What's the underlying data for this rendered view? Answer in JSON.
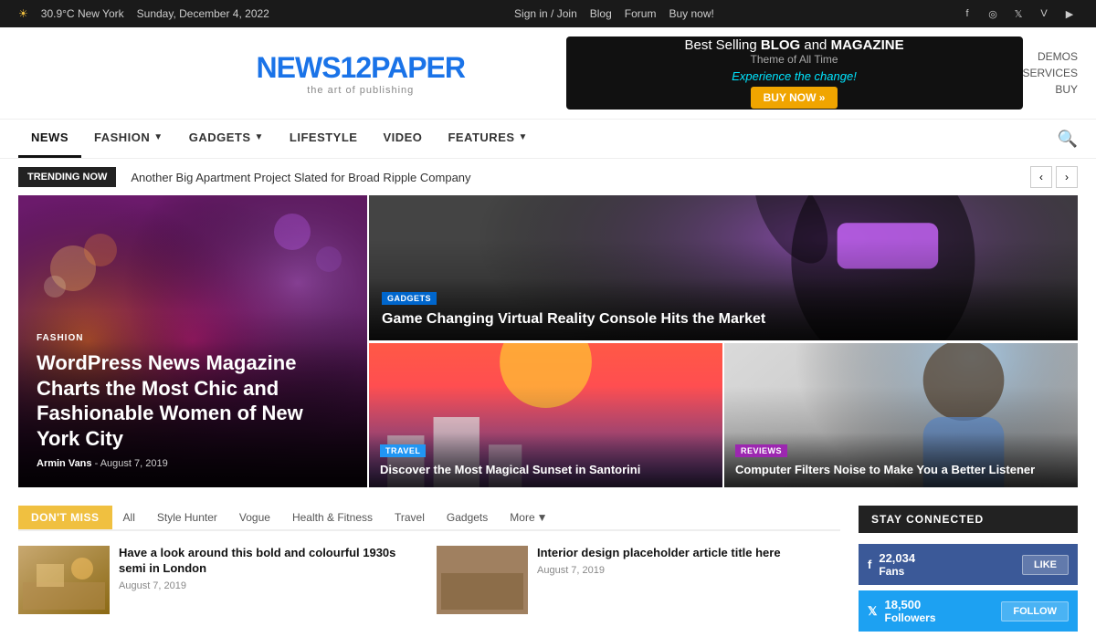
{
  "topbar": {
    "weather_icon": "☀",
    "temperature": "30.9",
    "temp_unit": "°C",
    "city": "New York",
    "date": "Sunday, December 4, 2022",
    "links": [
      "Sign in / Join",
      "Blog",
      "Forum",
      "Buy now!"
    ],
    "social_icons": [
      "f",
      "ig",
      "tw",
      "vi",
      "yt"
    ]
  },
  "logo": {
    "part1": "NEWS",
    "part2": "12",
    "part3": "PAPER",
    "tagline": "the art of publishing"
  },
  "ad": {
    "line1": "Best Selling BLOG and MAGAZINE",
    "line2": "Theme of All Time",
    "sub": "Experience the change!",
    "btn": "BUY NOW »"
  },
  "right_nav": {
    "items": [
      "DEMOS",
      "SERVICES",
      "BUY"
    ]
  },
  "nav": {
    "items": [
      {
        "label": "NEWS",
        "active": true,
        "has_dropdown": false
      },
      {
        "label": "FASHION",
        "active": false,
        "has_dropdown": true
      },
      {
        "label": "GADGETS",
        "active": false,
        "has_dropdown": true
      },
      {
        "label": "LIFESTYLE",
        "active": false,
        "has_dropdown": false
      },
      {
        "label": "VIDEO",
        "active": false,
        "has_dropdown": false
      },
      {
        "label": "FEATURES",
        "active": false,
        "has_dropdown": true
      }
    ]
  },
  "trending": {
    "label": "TRENDING NOW",
    "text": "Another Big Apartment Project Slated for Broad Ripple Company"
  },
  "hero_main": {
    "category": "FASHION",
    "title": "WordPress News Magazine Charts the Most Chic and Fashionable Women of New York City",
    "author": "Armin Vans",
    "date": "August 7, 2019"
  },
  "hero_top_right": {
    "category": "GADGETS",
    "title": "Game Changing Virtual Reality Console Hits the Market"
  },
  "hero_bottom_left": {
    "category": "TRAVEL",
    "title": "Discover the Most Magical Sunset in Santorini"
  },
  "hero_bottom_right": {
    "category": "REVIEWS",
    "title": "Computer Filters Noise to Make You a Better Listener"
  },
  "dont_miss": {
    "label": "DON'T MISS",
    "tabs": [
      "All",
      "Style Hunter",
      "Vogue",
      "Health & Fitness",
      "Travel",
      "Gadgets",
      "More"
    ],
    "articles": [
      {
        "title": "Have a look around this bold and colourful 1930s semi in London",
        "date": "August 7, 2019",
        "thumb": "bedroom"
      },
      {
        "title": "Interior design placeholder article title here",
        "date": "August 7, 2019",
        "thumb": "interior"
      }
    ]
  },
  "stay_connected": {
    "label": "STAY CONNECTED",
    "facebook": {
      "count": "22,034",
      "unit": "Fans",
      "btn": "LIKE"
    },
    "twitter": {
      "count": "18,500",
      "unit": "Followers",
      "btn": "FOLLOW"
    }
  }
}
